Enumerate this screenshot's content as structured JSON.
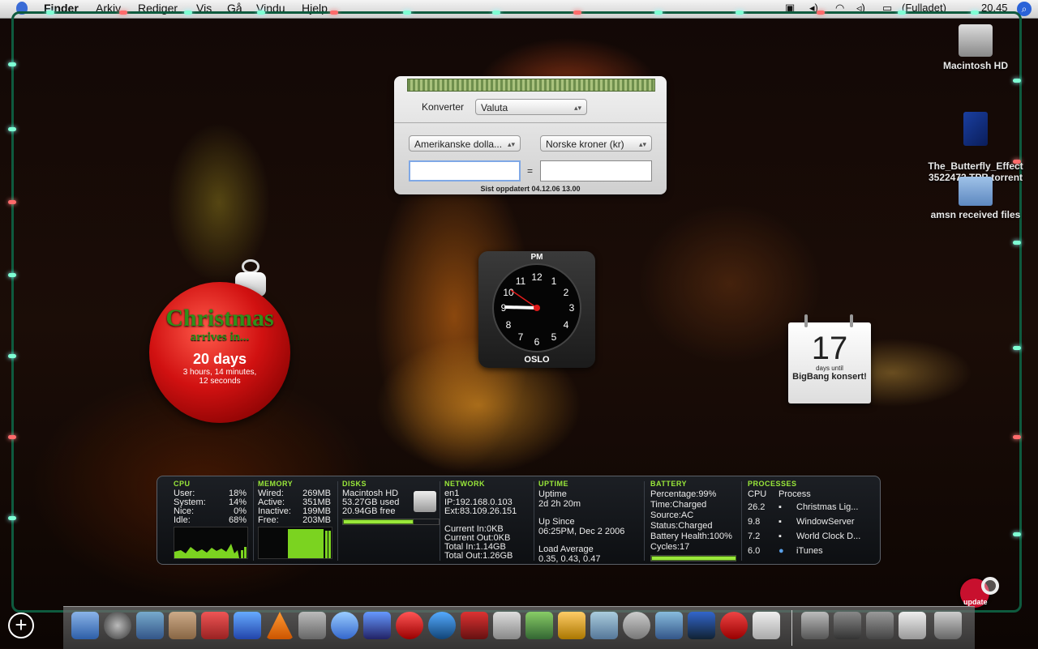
{
  "menubar": {
    "items": [
      "Finder",
      "Arkiv",
      "Rediger",
      "Vis",
      "Gå",
      "Vindu",
      "Hjelp"
    ],
    "battery_status": "(Fulladet)",
    "time": "20.45"
  },
  "desktop_icons": [
    {
      "label": "Macintosh HD"
    },
    {
      "label": "The_Butterfly_Effect\n3522472.TPB.torrent"
    },
    {
      "label": "amsn received files"
    }
  ],
  "converter": {
    "convert_label": "Konverter",
    "category": "Valuta",
    "from_currency": "Amerikanske dolla...",
    "to_currency": "Norske kroner (kr)",
    "from_value": "",
    "to_value": "",
    "equals": "=",
    "updated": "Sist oppdatert 04.12.06 13.00"
  },
  "clock": {
    "ampm": "PM",
    "city": "OSLO",
    "numbers": [
      "12",
      "1",
      "2",
      "3",
      "4",
      "5",
      "6",
      "7",
      "8",
      "9",
      "10",
      "11"
    ]
  },
  "countdown": {
    "title_line1": "Christmas",
    "title_line2": "arrives in...",
    "days": "20 days",
    "detail_line1": "3 hours, 14 minutes,",
    "detail_line2": "12 seconds"
  },
  "calendar": {
    "number": "17",
    "line1": "days until",
    "line2": "BigBang konsert!"
  },
  "istat": {
    "cpu": {
      "header": "CPU",
      "rows": [
        [
          "User:",
          "18%"
        ],
        [
          "System:",
          "14%"
        ],
        [
          "Nice:",
          "0%"
        ],
        [
          "Idle:",
          "68%"
        ]
      ]
    },
    "memory": {
      "header": "MEMORY",
      "rows": [
        [
          "Wired:",
          "269MB"
        ],
        [
          "Active:",
          "351MB"
        ],
        [
          "Inactive:",
          "199MB"
        ],
        [
          "Free:",
          "203MB"
        ]
      ]
    },
    "disks": {
      "header": "DISKS",
      "name": "Macintosh HD",
      "used": "53.27GB used",
      "free": "20.94GB free",
      "used_fraction": 0.72
    },
    "network": {
      "header": "NETWORK",
      "iface": "en1",
      "ip": "IP:192.168.0.103",
      "ext": "Ext:83.109.26.151",
      "current_in": "Current In:0KB",
      "current_out": "Current Out:0KB",
      "total_in": "Total In:1.14GB",
      "total_out": "Total Out:1.26GB"
    },
    "uptime": {
      "header": "UPTIME",
      "label": "Uptime",
      "value": "2d 2h 20m",
      "since_label": "Up Since",
      "since_value": "06:25PM, Dec 2 2006",
      "load_label": "Load Average",
      "load_value": "0.35, 0.43, 0.47"
    },
    "battery": {
      "header": "BATTERY",
      "percentage": "Percentage:99%",
      "time": "Time:Charged",
      "source": "Source:AC",
      "status": "Status:Charged",
      "health": "Battery Health:100%",
      "cycles": "Cycles:17",
      "fraction": 0.99
    },
    "processes": {
      "header": "PROCESSES",
      "col_cpu": "CPU",
      "col_process": "Process",
      "rows": [
        [
          "26.2",
          "Christmas Lig..."
        ],
        [
          "9.8",
          "WindowServer"
        ],
        [
          "7.2",
          "World Clock D..."
        ],
        [
          "6.0",
          "iTunes"
        ]
      ]
    }
  },
  "update_badge": {
    "label": "update"
  }
}
